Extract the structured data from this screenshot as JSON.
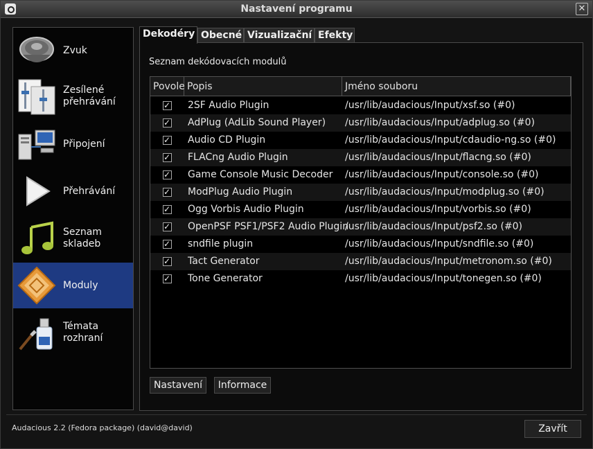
{
  "window": {
    "title": "Nastavení programu"
  },
  "sidebar": {
    "items": [
      {
        "label": "Zvuk",
        "icon": "speaker-icon"
      },
      {
        "label": "Zesílené přehrávání",
        "icon": "equalizer-sliders-icon"
      },
      {
        "label": "Připojení",
        "icon": "network-computers-icon"
      },
      {
        "label": "Přehrávání",
        "icon": "play-icon"
      },
      {
        "label": "Seznam skladeb",
        "icon": "music-note-icon"
      },
      {
        "label": "Moduly",
        "icon": "plugin-puzzle-icon"
      },
      {
        "label": "Témata rozhraní",
        "icon": "paint-brush-icon"
      }
    ],
    "selected": "Moduly"
  },
  "tabs": [
    "Dekodéry",
    "Obecné",
    "Vizualizační",
    "Efekty"
  ],
  "active_tab": "Dekodéry",
  "section_label": "Seznam dekódovacích modulů",
  "table": {
    "headers": [
      "Povole",
      "Popis",
      "Jméno souboru"
    ],
    "rows": [
      {
        "enabled": true,
        "desc": "2SF Audio Plugin",
        "file": "/usr/lib/audacious/Input/xsf.so (#0)"
      },
      {
        "enabled": true,
        "desc": "AdPlug (AdLib Sound Player)",
        "file": "/usr/lib/audacious/Input/adplug.so (#0)"
      },
      {
        "enabled": true,
        "desc": "Audio CD Plugin",
        "file": "/usr/lib/audacious/Input/cdaudio-ng.so (#0)"
      },
      {
        "enabled": true,
        "desc": "FLACng Audio Plugin",
        "file": "/usr/lib/audacious/Input/flacng.so (#0)"
      },
      {
        "enabled": true,
        "desc": "Game Console Music Decoder",
        "file": "/usr/lib/audacious/Input/console.so (#0)"
      },
      {
        "enabled": true,
        "desc": "ModPlug Audio Plugin",
        "file": "/usr/lib/audacious/Input/modplug.so (#0)"
      },
      {
        "enabled": true,
        "desc": "Ogg Vorbis Audio Plugin",
        "file": "/usr/lib/audacious/Input/vorbis.so (#0)"
      },
      {
        "enabled": true,
        "desc": "OpenPSF PSF1/PSF2 Audio Plugin",
        "file": "/usr/lib/audacious/Input/psf2.so (#0)"
      },
      {
        "enabled": true,
        "desc": "sndfile plugin",
        "file": "/usr/lib/audacious/Input/sndfile.so (#0)"
      },
      {
        "enabled": true,
        "desc": "Tact Generator",
        "file": "/usr/lib/audacious/Input/metronom.so (#0)"
      },
      {
        "enabled": true,
        "desc": "Tone Generator",
        "file": "/usr/lib/audacious/Input/tonegen.so (#0)"
      }
    ]
  },
  "buttons": {
    "settings": "Nastavení",
    "info": "Informace",
    "close": "Zavřít"
  },
  "footer": {
    "version": "Audacious 2.2 (Fedora package) (david@david)"
  },
  "colors": {
    "selection": "#1e3a82",
    "background": "#000000"
  }
}
